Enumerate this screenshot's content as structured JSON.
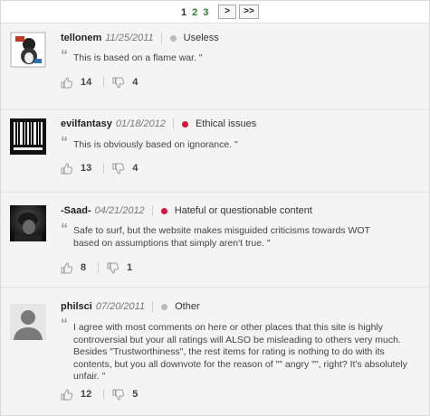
{
  "pagination": {
    "pages": [
      "1",
      "2",
      "3"
    ],
    "current": "1",
    "next_label": ">",
    "last_label": ">>"
  },
  "comments": [
    {
      "username": "tellonem",
      "date": "11/25/2011",
      "category": "Useless",
      "category_color": "#bbbbbb",
      "text": "This is based on a flame war. \"",
      "upvotes": "14",
      "downvotes": "4"
    },
    {
      "username": "evilfantasy",
      "date": "01/18/2012",
      "category": "Ethical issues",
      "category_color": "#d6143d",
      "text": "This is obviously based on ignorance. \"",
      "upvotes": "13",
      "downvotes": "4"
    },
    {
      "username": "-Saad-",
      "date": "04/21/2012",
      "category": "Hateful or questionable content",
      "category_color": "#d6143d",
      "text": "Safe to surf, but the website makes misguided criticisms towards WOT based on assumptions that simply aren't true. \"",
      "upvotes": "8",
      "downvotes": "1"
    },
    {
      "username": "philsci",
      "date": "07/20/2011",
      "category": "Other",
      "category_color": "#bbbbbb",
      "text": "I agree with most comments on here or other places that this site is highly controversial but your all ratings will ALSO be misleading to others very much. Besides \"Trustworthiness\", the rest items for rating is nothing to do with its contents, but you all downvote for the reason of \"\" angry \"\", right? It's absolutely unfair. \"",
      "upvotes": "12",
      "downvotes": "5"
    }
  ]
}
